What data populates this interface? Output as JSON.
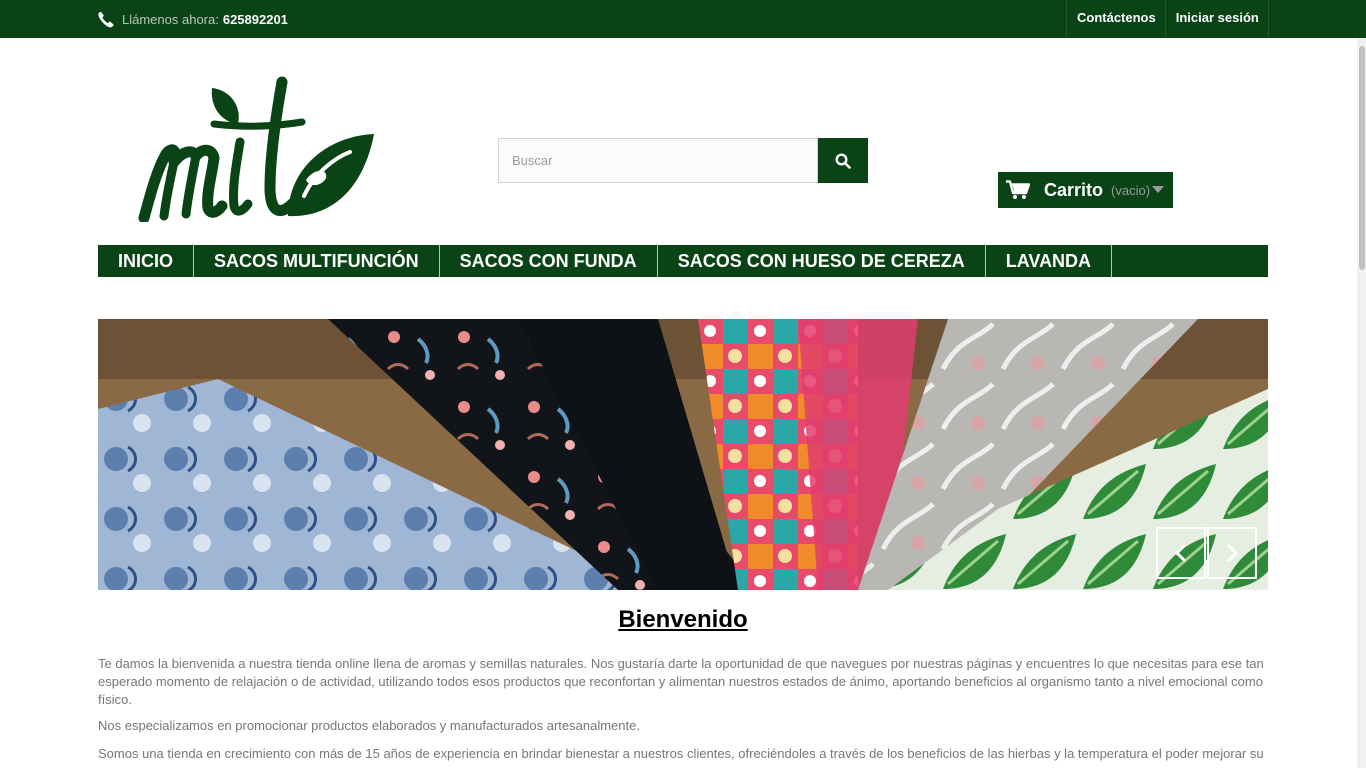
{
  "topbar": {
    "phone_label": "Llámenos ahora:",
    "phone_number": "625892201",
    "links": [
      "Contáctenos",
      "Iniciar sesión"
    ]
  },
  "logo": {
    "text": "mite"
  },
  "search": {
    "placeholder": "Buscar",
    "icon": "search-icon"
  },
  "cart": {
    "label": "Carrito",
    "status": "(vacio)",
    "icon": "shopping-cart-icon"
  },
  "menu": {
    "items": [
      "INICIO",
      "SACOS MULTIFUNCIÓN",
      "SACOS CON FUNDA",
      "SACOS CON HUESO DE CEREZA",
      "LAVANDA"
    ]
  },
  "slider": {
    "prev_icon": "chevron-left-icon",
    "next_icon": "chevron-right-icon"
  },
  "content": {
    "title": "Bienvenido",
    "paragraphs": [
      "Te damos la bienvenida a nuestra tienda online llena de aromas y semillas naturales. Nos gustaría darte la oportunidad de que navegues por nuestras páginas y encuentres lo que necesitas para ese tan esperado momento de relajación o de actividad, utilizando todos esos productos que reconfortan y alimentan nuestros estados de ánimo, aportando beneficios al organismo tanto a nivel emocional como físico.",
      "Nos especializamos en promocionar productos elaborados y manufacturados artesanalmente.",
      "Somos una tienda en crecimiento con más de 15 años de experiencia en brindar bienestar a nuestros clientes, ofreciéndoles a través de los beneficios de las hierbas y la temperatura el poder mejorar su"
    ]
  },
  "colors": {
    "brand_green": "#0a4416",
    "text_gray": "#777777",
    "white": "#ffffff"
  }
}
